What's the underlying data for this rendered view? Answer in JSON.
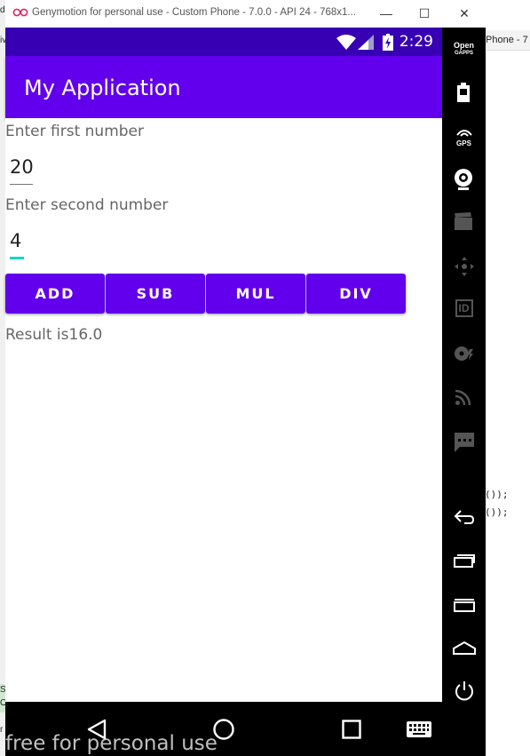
{
  "window": {
    "title": "Genymotion for personal use - Custom Phone - 7.0.0 - API 24 - 768x1...",
    "minimize": "—",
    "maximize": "☐",
    "close": "✕"
  },
  "status_bar": {
    "time": "2:29"
  },
  "app": {
    "title": "My Application",
    "first_label": "Enter first number",
    "first_value": "20",
    "second_label": "Enter second number",
    "second_value": "4",
    "buttons": {
      "add": "ADD",
      "sub": "SUB",
      "mul": "MUL",
      "div": "DIV"
    },
    "result": "Result is16.0"
  },
  "sidebar": {
    "gapps_line1": "Open",
    "gapps_line2": "GAPPS",
    "gps": "GPS",
    "id": "ID"
  },
  "watermark": "free for personal use",
  "background": {
    "right_tab": "Phone - 7",
    "code_line1": "());",
    "code_line2": "());",
    "left_chars": [
      "d",
      "iv",
      "Su",
      "O",
      "r"
    ]
  },
  "colors": {
    "primary": "#6200ee",
    "primary_dark": "#3700b3",
    "accent": "#03dac5"
  }
}
